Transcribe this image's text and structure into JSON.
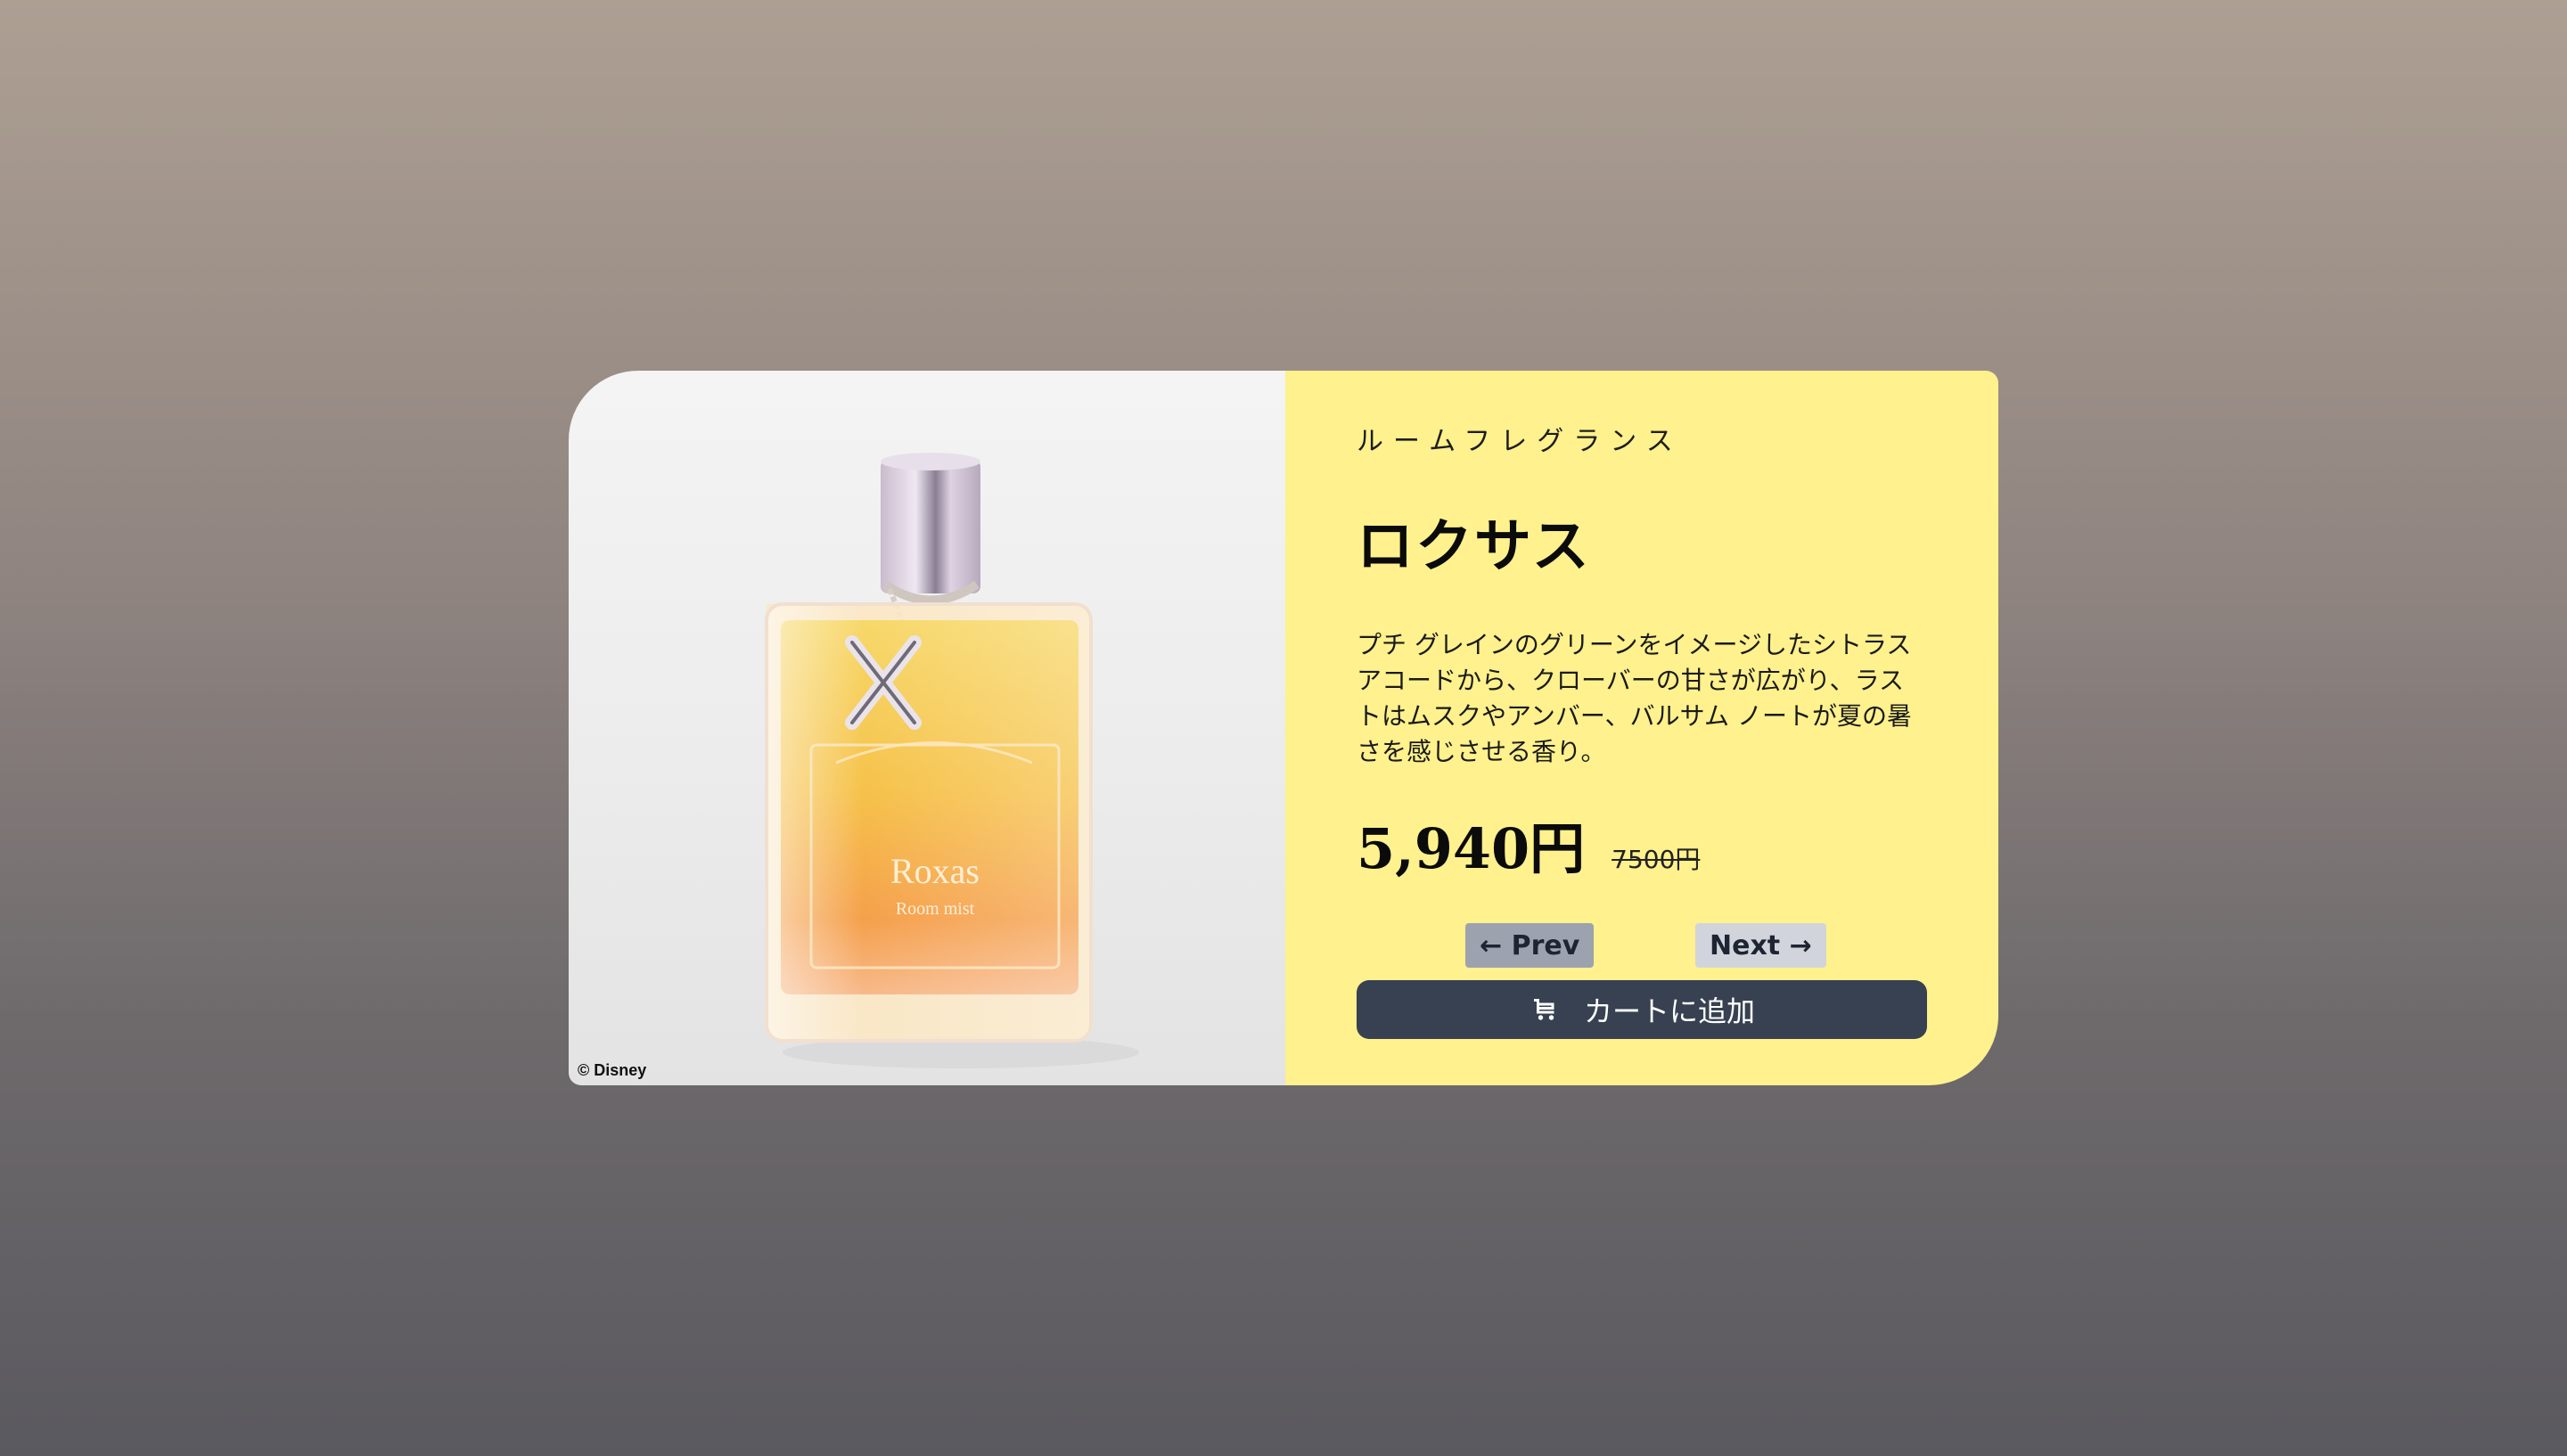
{
  "product": {
    "image_alt": "Roxas Room mist bottle",
    "image_label": "Roxas",
    "image_sublabel": "Room mist",
    "copyright": "© Disney",
    "category": "ルームフレグランス",
    "name": "ロクサス",
    "description": "プチ グレインのグリーンをイメージしたシトラス アコードから、クローバーの甘さが広がり、ラストはムスクやアンバー、バルサム ノートが夏の暑さを感じさせる香り。",
    "price": "5,940円",
    "original_price": "7500円"
  },
  "navigation": {
    "prev_label": "← Prev",
    "next_label": "Next →"
  },
  "cart": {
    "button_label": "カートに追加",
    "icon": "cart-icon"
  },
  "colors": {
    "info_panel": "#fff18d",
    "cart_button": "#374151",
    "prev_button": "#9ca3af",
    "next_button": "#d1d5db"
  }
}
